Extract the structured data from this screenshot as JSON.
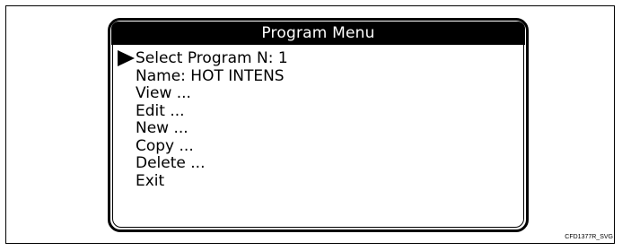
{
  "menu": {
    "title": "Program Menu",
    "items": [
      {
        "label": "Select Program N: 1",
        "selected": true
      },
      {
        "label": "Name: HOT INTENS",
        "selected": false
      },
      {
        "label": "View ...",
        "selected": false
      },
      {
        "label": "Edit ...",
        "selected": false
      },
      {
        "label": "New ...",
        "selected": false
      },
      {
        "label": "Copy ...",
        "selected": false
      },
      {
        "label": "Delete ...",
        "selected": false
      },
      {
        "label": "Exit",
        "selected": false
      }
    ]
  },
  "figure": {
    "code": "CFD1377R_SVG"
  },
  "colors": {
    "foreground": "#000000",
    "background": "#ffffff",
    "title_text": "#ffffff"
  },
  "icons": {
    "cursor": "triangle-right-icon"
  }
}
